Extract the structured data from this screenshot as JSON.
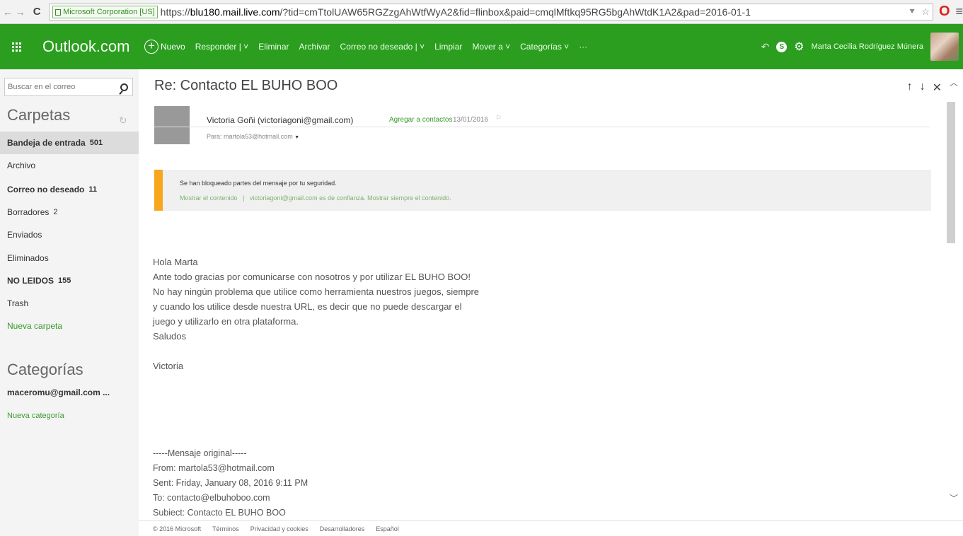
{
  "browser": {
    "cert_label": "Microsoft Corporation [US]",
    "url_prefix": "https://",
    "url_domain": "blu180.mail.live.com",
    "url_rest": "/?tid=cmTtolUAW65RGZzgAhWtfWyA2&fid=flinbox&paid=cmqlMftkq95RG5bgAhWtdK1A2&pad=2016-01-1"
  },
  "topbar": {
    "brand": "Outlook.com",
    "new_label": "Nuevo",
    "commands": [
      "Responder | ˅",
      "Eliminar",
      "Archivar",
      "Correo no deseado | ˅",
      "Limpiar",
      "Mover a ˅",
      "Categorías ˅",
      "···"
    ],
    "username": "Marta Cecilia Rodríguez Múnera"
  },
  "sidebar": {
    "search_placeholder": "Buscar en el correo",
    "folders_title": "Carpetas",
    "folders": [
      {
        "label": "Bandeja de entrada",
        "count": "501"
      },
      {
        "label": "Archivo",
        "count": ""
      },
      {
        "label": "Correo no deseado",
        "count": "11"
      },
      {
        "label": "Borradores",
        "count": "2"
      },
      {
        "label": "Enviados",
        "count": ""
      },
      {
        "label": "Eliminados",
        "count": ""
      },
      {
        "label": "NO LEIDOS",
        "count": "155"
      },
      {
        "label": "Trash",
        "count": ""
      },
      {
        "label": "Nueva carpeta",
        "count": ""
      }
    ],
    "categories_title": "Categorías",
    "category_item": "maceromu@gmail.com ...",
    "new_category": "Nueva categoría"
  },
  "message": {
    "subject": "Re: Contacto EL BUHO BOO",
    "sender": "Victoria Goñi (victoriagoni@gmail.com)",
    "add_contact": "Agregar a contactos",
    "date": "13/01/2016",
    "to": "Para: martola53@hotmail.com",
    "security_notice": "Se han bloqueado partes del mensaje por tu seguridad.",
    "show_content": "Mostrar el contenido",
    "trust_link": "victoriagoni@gmail.com es de confianza. Mostrar siempre el contenido.",
    "body": [
      "Hola Marta",
      "Ante todo gracias por comunicarse con nosotros y por utilizar EL BUHO BOO!",
      "No hay ningún problema que utilice como herramienta nuestros juegos, siempre",
      "y cuando los utilice desde nuestra URL, es decir que no puede descargar el",
      "juego y utilizarlo en otra plataforma.",
      "Saludos",
      "",
      "Victoria"
    ],
    "original": [
      "-----Mensaje original-----",
      "From: martola53@hotmail.com",
      "Sent: Friday, January 08, 2016 9:11 PM",
      "To: contacto@elbuhoboo.com",
      "Subject: Contacto EL BUHO BOO"
    ]
  },
  "footer": {
    "copyright": "© 2016 Microsoft",
    "terms": "Términos",
    "privacy": "Privacidad y cookies",
    "developers": "Desarrolladores",
    "language": "Español"
  },
  "colors": {
    "brand_green": "#2b9e1f",
    "warning_bar": "#f8a61d",
    "link_green": "#3a9a2d"
  }
}
